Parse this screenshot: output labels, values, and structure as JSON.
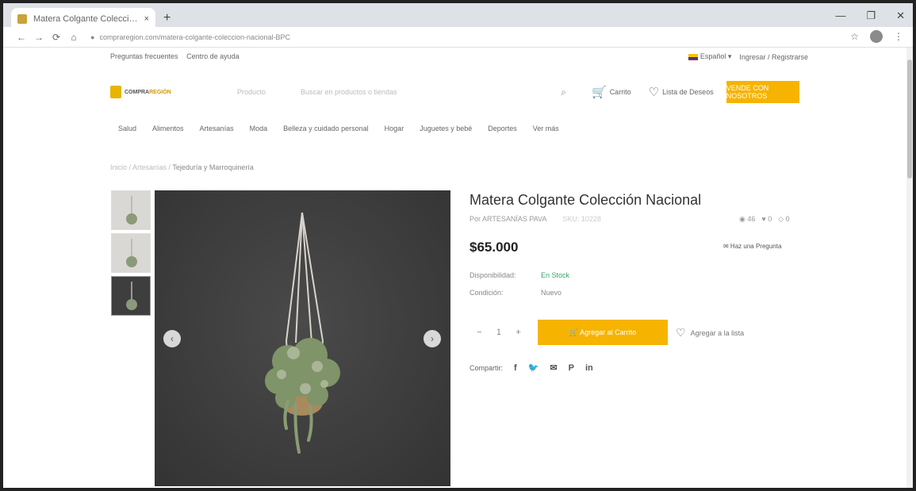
{
  "browser": {
    "tab_title": "Matera Colgante Colección Nacional",
    "tab_close": "×",
    "new_tab": "+",
    "url": "compraregion.com/matera-colgante-coleccion-nacional-BPC",
    "nav": {
      "back": "←",
      "forward": "→",
      "reload": "⟳",
      "home": "⌂"
    },
    "window": {
      "minimize": "—",
      "restore": "❐",
      "close": "✕"
    },
    "right": {
      "star": "☆",
      "menu": "⋮"
    }
  },
  "topbar": {
    "faq": "Preguntas frecuentes",
    "help": "Centro de ayuda",
    "language": "Español",
    "language_caret": "▾",
    "login": "Ingresar",
    "separator": "/",
    "register": "Registrarse"
  },
  "header": {
    "logo_a": "COMPRA",
    "logo_b": "REGIÓN",
    "category": "Producto",
    "search_placeholder": "Buscar en productos o tiendas",
    "search_icon": "⌕",
    "cart_label": "Carrito",
    "cart_icon": "🛒",
    "wishlist_label": "Lista de Deseos",
    "wishlist_icon": "♡",
    "sell_button": "VENDE CON NOSOTROS"
  },
  "menu": [
    "Salud",
    "Alimentos",
    "Artesanías",
    "Moda",
    "Belleza y cuidado personal",
    "Hogar",
    "Juguetes y bebé",
    "Deportes",
    "Ver más"
  ],
  "breadcrumb": {
    "path": "Inicio / Artesanías /",
    "current": "Tejeduría y Marroquinería"
  },
  "gallery": {
    "prev": "‹",
    "next": "›"
  },
  "product": {
    "title": "Matera Colgante Colección Nacional",
    "seller": "Por ARTESANÍAS PAVA",
    "sku": "SKU: 10228",
    "views": "◉ 46",
    "likes": "♥ 0",
    "shares": "◇ 0",
    "price": "$65.000",
    "ask_question": "✉ Haz una Pregunta",
    "availability_label": "Disponibilidad:",
    "availability_value": "En Stock",
    "condition_label": "Condición:",
    "condition_value": "Nuevo",
    "qty_minus": "−",
    "qty_value": "1",
    "qty_plus": "+",
    "add_to_cart": "🛒 Agregar al Carrito",
    "add_to_wishlist": "Agregar a la lista",
    "wishlist_icon": "♡",
    "share_label": "Compartir:",
    "share_icons": [
      "f",
      "🐦",
      "✉",
      "P",
      "in"
    ]
  },
  "colors": {
    "accent": "#f6b400",
    "in_stock": "#35a36b"
  }
}
